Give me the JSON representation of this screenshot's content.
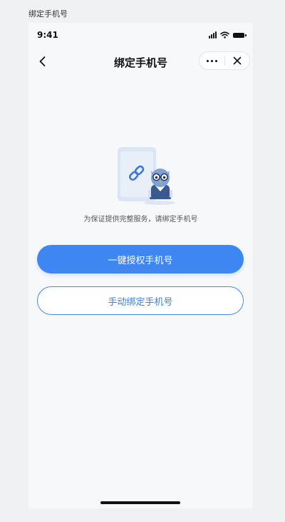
{
  "page_caption": "绑定手机号",
  "status_bar": {
    "time": "9:41"
  },
  "nav": {
    "title": "绑定手机号"
  },
  "main": {
    "tip": "为保证提供完整服务，请绑定手机号",
    "primary_button": "一键授权手机号",
    "secondary_button": "手动绑定手机号"
  },
  "colors": {
    "accent": "#3E86F2",
    "background": "#F7F8FA"
  },
  "icons": [
    "chevron-left-icon",
    "more-dots-icon",
    "close-icon",
    "signal-icon",
    "wifi-icon",
    "battery-icon",
    "phone-link-illustration"
  ]
}
